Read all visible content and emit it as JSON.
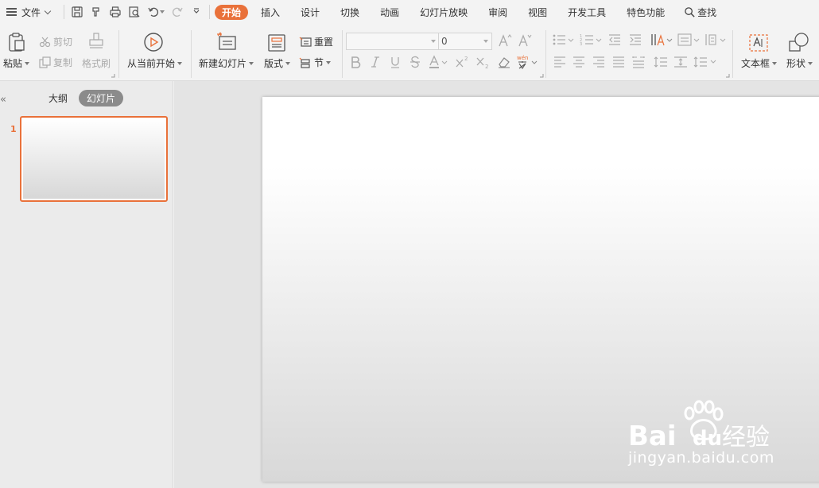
{
  "menu": {
    "file_label": "文件",
    "tabs": [
      "开始",
      "插入",
      "设计",
      "切换",
      "动画",
      "幻灯片放映",
      "审阅",
      "视图",
      "开发工具",
      "特色功能"
    ],
    "search_label": "查找"
  },
  "ribbon": {
    "paste_label": "粘贴",
    "cut_label": "剪切",
    "copy_label": "复制",
    "format_painter_label": "格式刷",
    "play_from_current_label": "从当前开始",
    "new_slide_label": "新建幻灯片",
    "layout_label": "版式",
    "reset_label": "重置",
    "section_label": "节",
    "font_name_value": "",
    "font_size_value": "0",
    "textbox_label": "文本框",
    "shape_label": "形状"
  },
  "panel": {
    "outline_tab": "大纲",
    "slides_tab": "幻灯片",
    "slide_numbers": [
      "1"
    ]
  },
  "watermark": {
    "brand": "Bai",
    "brand2": "du",
    "product": "经验",
    "url": "jingyan.baidu.com"
  },
  "colors": {
    "accent": "#e9713a",
    "background": "#f3f3f3"
  }
}
